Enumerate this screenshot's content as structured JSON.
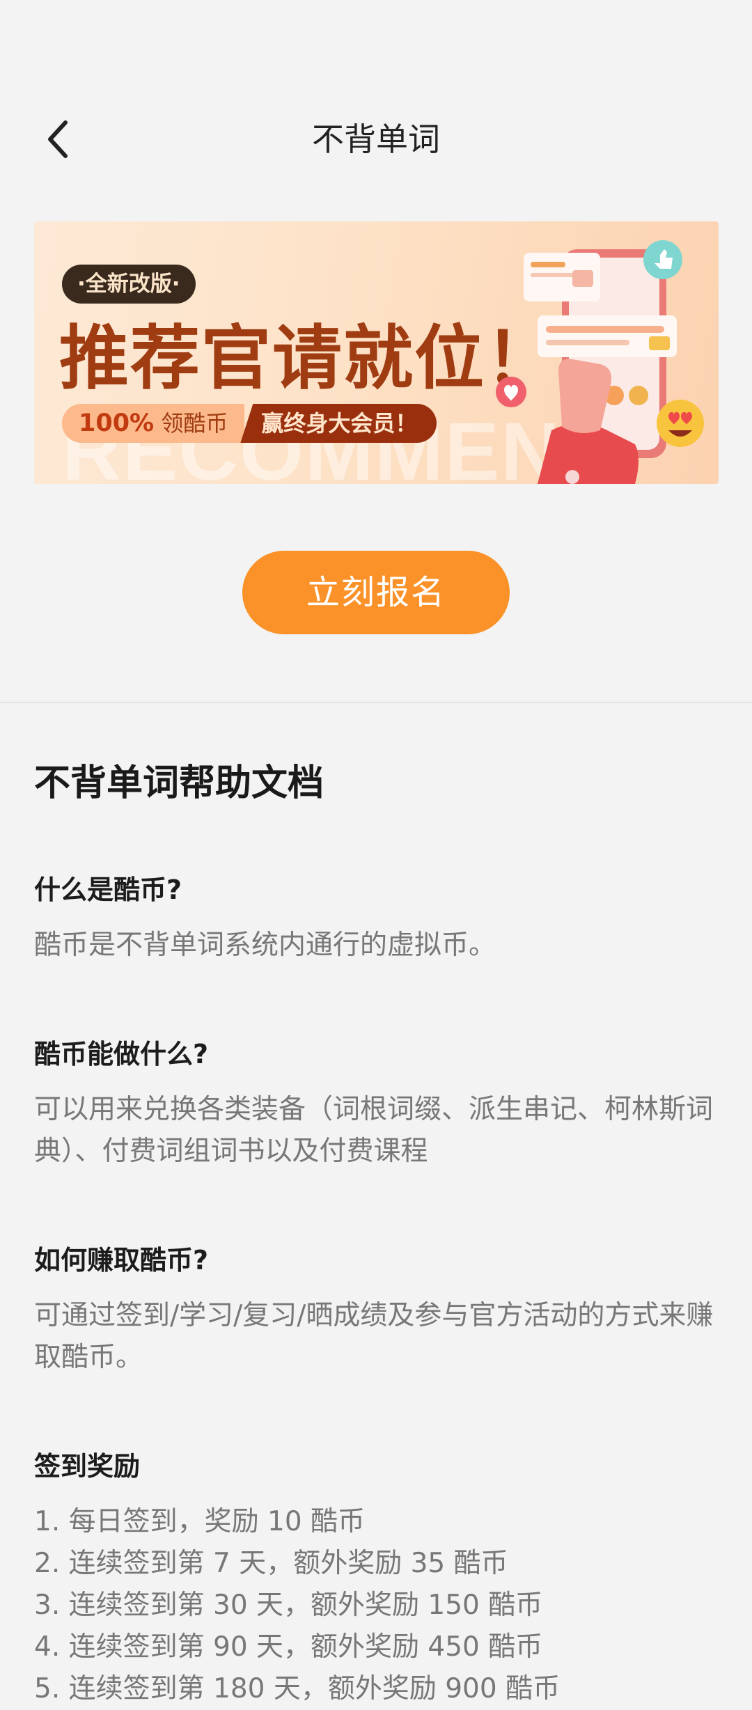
{
  "header": {
    "title": "不背单词",
    "back_icon": "chevron-left-icon"
  },
  "banner": {
    "badge": "·全新改版·",
    "headline": "推荐官请就位！",
    "strip_number": "100%",
    "strip_left": " 领酷币",
    "strip_right": "赢终身大会员！",
    "watermark": "RECOMMEND"
  },
  "enroll_button": "立刻报名",
  "doc": {
    "title": "不背单词帮助文档",
    "sections": [
      {
        "question": "什么是酷币?",
        "answer": "酷币是不背单词系统内通行的虚拟币。"
      },
      {
        "question": "酷币能做什么?",
        "answer": "可以用来兑换各类装备（词根词缀、派生串记、柯林斯词典）、付费词组词书以及付费课程"
      },
      {
        "question": "如何赚取酷币?",
        "answer": "可通过签到/学习/复习/晒成绩及参与官方活动的方式来赚取酷币。"
      }
    ],
    "signin": {
      "heading": "签到奖励",
      "items": [
        "1. 每日签到，奖励 10 酷币",
        "2. 连续签到第 7 天，额外奖励 35 酷币",
        "3. 连续签到第 30 天，额外奖励 150 酷币",
        "4. 连续签到第 90 天，额外奖励 450 酷币",
        "5. 连续签到第 180 天，额外奖励 900 酷币"
      ]
    }
  },
  "colors": {
    "accent": "#fb9229",
    "background": "#f3f3f3",
    "banner_red": "#a03c12"
  }
}
